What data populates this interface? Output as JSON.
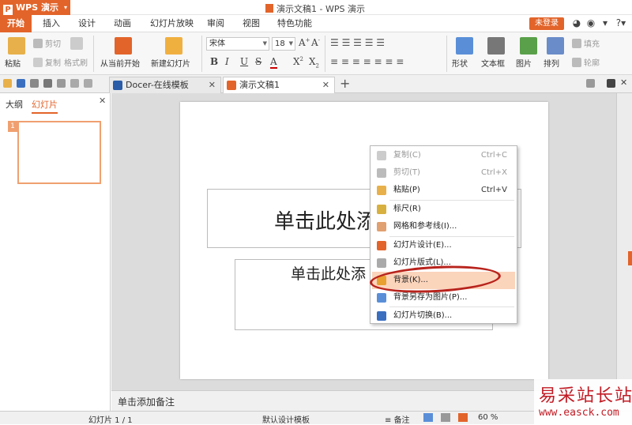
{
  "app": {
    "name": "WPS 演示",
    "logo_letter": "P"
  },
  "window": {
    "title": "演示文稿1 - WPS 演示",
    "login_label": "未登录"
  },
  "menu": {
    "items": [
      "开始",
      "插入",
      "设计",
      "动画",
      "幻灯片放映",
      "审阅",
      "视图",
      "特色功能"
    ],
    "active_index": 0
  },
  "ribbon": {
    "paste": "粘贴",
    "cut": "剪切",
    "copy": "复制",
    "format_painter": "格式刷",
    "from_current": "从当前开始",
    "new_slide": "新建幻灯片",
    "font_name": "宋体",
    "font_size": "18",
    "shape": "形状",
    "textbox": "文本框",
    "picture": "图片",
    "arrange": "排列",
    "fill": "填充",
    "outline": "轮廓"
  },
  "tabs": [
    {
      "label": "Docer-在线模板"
    },
    {
      "label": "演示文稿1"
    }
  ],
  "left_panel": {
    "tab_outline": "大纲",
    "tab_slides": "幻灯片",
    "slide_number": "1"
  },
  "slide": {
    "title_placeholder": "单击此处添",
    "subtitle_placeholder": "单击此处添"
  },
  "context_menu": [
    {
      "label": "复制(C)",
      "shortcut": "Ctrl+C",
      "disabled": true,
      "icon": "copy-icon"
    },
    {
      "label": "剪切(T)",
      "shortcut": "Ctrl+X",
      "disabled": true,
      "icon": "cut-icon"
    },
    {
      "label": "粘贴(P)",
      "shortcut": "Ctrl+V",
      "disabled": false,
      "icon": "paste-icon"
    },
    {
      "label": "标尺(R)",
      "shortcut": "",
      "disabled": false,
      "icon": "ruler-icon"
    },
    {
      "label": "网格和参考线(I)...",
      "shortcut": "",
      "disabled": false,
      "icon": "grid-icon"
    },
    {
      "label": "幻灯片设计(E)...",
      "shortcut": "",
      "disabled": false,
      "icon": "slide-design-icon"
    },
    {
      "label": "幻灯片版式(L)...",
      "shortcut": "",
      "disabled": false,
      "icon": "slide-layout-icon"
    },
    {
      "label": "背景(K)...",
      "shortcut": "",
      "disabled": false,
      "icon": "background-icon",
      "highlighted": true
    },
    {
      "label": "背景另存为图片(P)...",
      "shortcut": "",
      "disabled": false,
      "icon": "save-background-icon"
    },
    {
      "label": "幻灯片切换(B)...",
      "shortcut": "",
      "disabled": false,
      "icon": "transition-icon"
    }
  ],
  "notes": {
    "placeholder": "单击添加备注"
  },
  "status_bar": {
    "slide_info": "幻灯片 1 / 1",
    "template": "默认设计模板",
    "notes_label": "备注",
    "zoom": "60 %"
  },
  "watermark": {
    "line1": "易采站长站",
    "line2": "www.easck.com"
  },
  "colors": {
    "accent": "#e2642a",
    "highlight": "#fbd4bc",
    "annotation": "#b8231c"
  }
}
